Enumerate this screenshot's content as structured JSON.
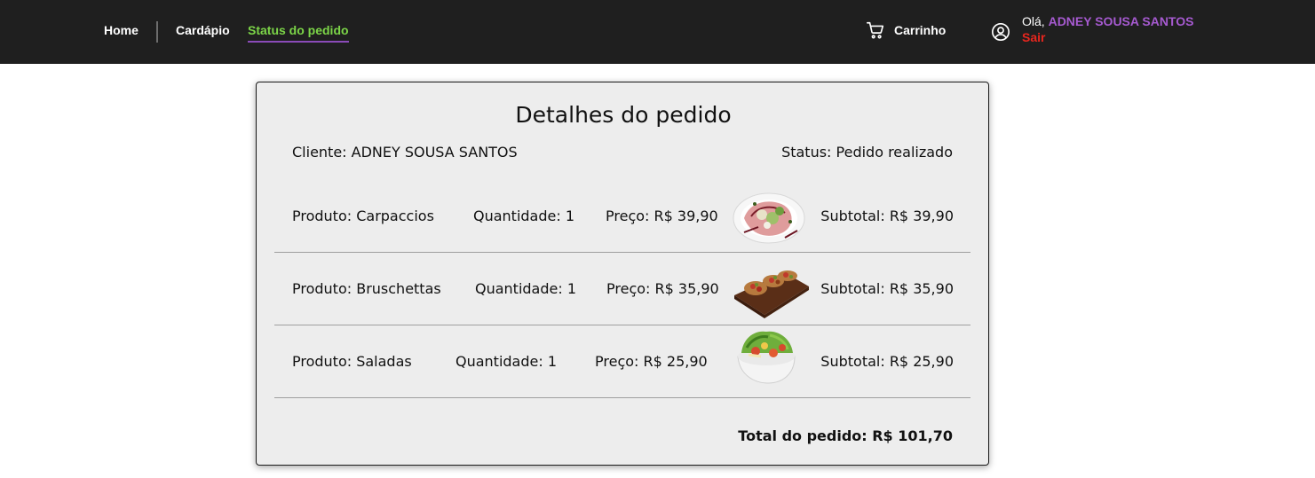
{
  "nav": {
    "home": "Home",
    "cardapio": "Cardápio",
    "status": "Status do pedido"
  },
  "header": {
    "cart_label": "Carrinho",
    "greeting": "Olá,",
    "user_name": "ADNEY SOUSA SANTOS",
    "logout": "Sair"
  },
  "colors": {
    "topbar": "#1f1f1f",
    "active_nav": "#7cd548",
    "active_underline": "#8a4bb8",
    "user_name": "#a65ad0",
    "logout": "#e8261e"
  },
  "order": {
    "title": "Detalhes do pedido",
    "client": "Cliente: ADNEY SOUSA SANTOS",
    "status": "Status: Pedido realizado",
    "items": [
      {
        "product": "Produto: Carpaccios",
        "quantity": "Quantidade: 1",
        "price": "Preço: R$ 39,90",
        "subtotal": "Subtotal: R$ 39,90",
        "image": "carpaccio-plate"
      },
      {
        "product": "Produto: Bruschettas",
        "quantity": "Quantidade: 1",
        "price": "Preço: R$ 35,90",
        "subtotal": "Subtotal: R$ 35,90",
        "image": "bruschetta-board"
      },
      {
        "product": "Produto: Saladas",
        "quantity": "Quantidade: 1",
        "price": "Preço: R$ 25,90",
        "subtotal": "Subtotal: R$ 25,90",
        "image": "salad-bowl"
      }
    ],
    "total": "Total do pedido: R$ 101,70"
  }
}
